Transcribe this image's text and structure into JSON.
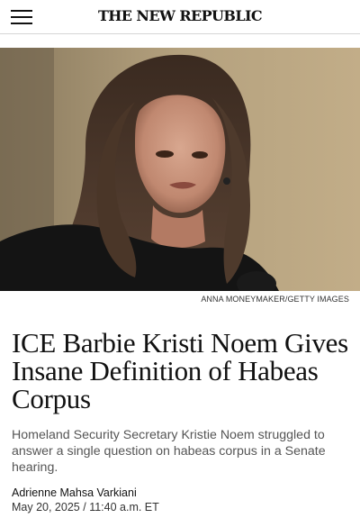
{
  "header": {
    "logo_text": "THE NEW REPUBLIC",
    "menu_icon": "hamburger-menu-icon"
  },
  "hero": {
    "photo_credit": "ANNA MONEYMAKER/GETTY IMAGES"
  },
  "article": {
    "headline": "ICE Barbie Kristi Noem Gives Insane Definition of Habeas Corpus",
    "dek": "Homeland Security Secretary Kristie Noem struggled to answer a single question on habeas corpus in a Senate hearing.",
    "author": "Adrienne Mahsa Varkiani",
    "date": "May 20, 2025",
    "separator": "/",
    "time": "11:40 a.m. ET"
  }
}
